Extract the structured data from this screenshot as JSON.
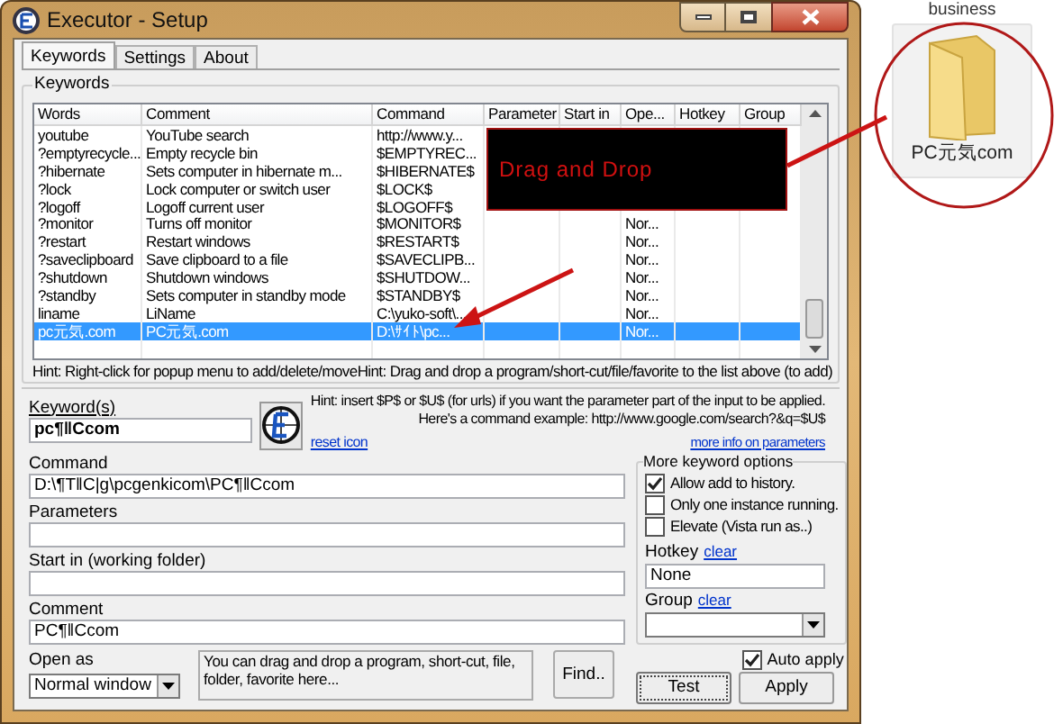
{
  "window": {
    "title": "Executor - Setup"
  },
  "tabs": [
    {
      "label": "Keywords",
      "selected": true
    },
    {
      "label": "Settings",
      "selected": false
    },
    {
      "label": "About",
      "selected": false
    }
  ],
  "keywords_group": {
    "label": "Keywords"
  },
  "table": {
    "columns": [
      "Words",
      "Comment",
      "Command",
      "Parameter",
      "Start in",
      "Ope...",
      "Hotkey",
      "Group"
    ],
    "rows": [
      {
        "words": "youtube",
        "comment": "YouTube search",
        "command": "http://www.y...",
        "selected": false
      },
      {
        "words": "?emptyrecycle...",
        "comment": "Empty recycle bin",
        "command": "$EMPTYREC...",
        "selected": false
      },
      {
        "words": "?hibernate",
        "comment": "Sets computer in hibernate m...",
        "command": "$HIBERNATE$",
        "selected": false
      },
      {
        "words": "?lock",
        "comment": "Lock computer or switch user",
        "command": "$LOCK$",
        "selected": false
      },
      {
        "words": "?logoff",
        "comment": "Logoff current user",
        "command": "$LOGOFF$",
        "selected": false
      },
      {
        "words": "?monitor",
        "comment": "Turns off monitor",
        "command": "$MONITOR$",
        "open_as": "Nor...",
        "selected": false
      },
      {
        "words": "?restart",
        "comment": "Restart windows",
        "command": "$RESTART$",
        "open_as": "Nor...",
        "selected": false
      },
      {
        "words": "?saveclipboard",
        "comment": "Save clipboard to a file",
        "command": "$SAVECLIPB...",
        "open_as": "Nor...",
        "selected": false
      },
      {
        "words": "?shutdown",
        "comment": "Shutdown windows",
        "command": "$SHUTDOW...",
        "open_as": "Nor...",
        "selected": false
      },
      {
        "words": "?standby",
        "comment": "Sets computer in standby mode",
        "command": "$STANDBY$",
        "open_as": "Nor...",
        "selected": false
      },
      {
        "words": "liname",
        "comment": "LiName",
        "command": "C:\\yuko-soft\\...",
        "open_as": "Nor...",
        "selected": false
      },
      {
        "words": "pc元気.com",
        "comment": "PC元気.com",
        "command": "D:\\ｻｲﾄ\\pc...",
        "open_as": "Nor...",
        "selected": true
      }
    ]
  },
  "hints": [
    "Hint: Right-click for popup menu to add/delete/move",
    "Hint: Drag and drop a program/short-cut/file/favorite to the list above (to add)"
  ],
  "keyword": {
    "label": "Keyword(s)",
    "value": "pc¶‖Ccom"
  },
  "reset_icon": "reset icon",
  "param_hint": [
    "Hint: insert $P$ or $U$ (for urls) if you want the parameter part of the input to be applied.",
    "Here's a command example: http://www.google.com/search?&q=$U$"
  ],
  "more_info": "more info on parameters",
  "command": {
    "label": "Command",
    "value": "D:\\¶T‖C|g\\pcgenkicom\\PC¶‖Ccom"
  },
  "parameters": {
    "label": "Parameters"
  },
  "start_in": {
    "label": "Start in (working folder)"
  },
  "comment": {
    "label": "Comment",
    "value": "PC¶‖Ccom"
  },
  "open_as": {
    "label": "Open as",
    "value": "Normal window"
  },
  "drop_hint": "You can drag and drop a program, short-cut, file, folder, favorite here...",
  "find_button": "Find..",
  "options": {
    "title": "More keyword options",
    "checkboxes": [
      {
        "label": "Allow add to history.",
        "checked": true
      },
      {
        "label": "Only one instance running.",
        "checked": false
      },
      {
        "label": "Elevate (Vista run as..)",
        "checked": false
      }
    ],
    "hotkey": {
      "label": "Hotkey",
      "clear": "clear",
      "value": "None"
    },
    "group": {
      "label": "Group",
      "clear": "clear"
    }
  },
  "auto_apply": {
    "label": "Auto apply",
    "checked": true
  },
  "buttons": {
    "test": "Test",
    "apply": "Apply"
  },
  "callout": "Drag and Drop",
  "desktop": {
    "caption": "business",
    "folder": "PC元気com"
  }
}
